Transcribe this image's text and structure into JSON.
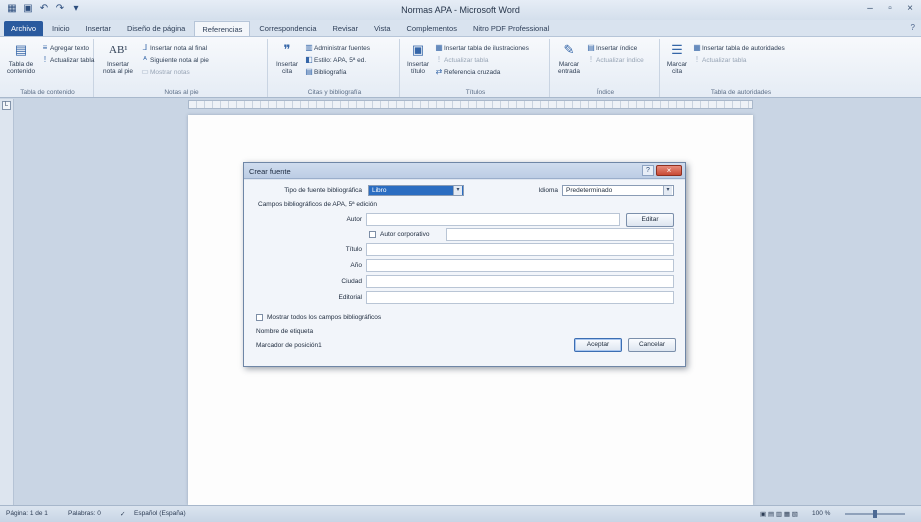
{
  "window": {
    "title": "Normas APA - Microsoft Word",
    "controls": [
      "–",
      "▫",
      "×"
    ]
  },
  "qat": [
    "▦",
    "▣",
    "↶",
    "↷",
    "▾"
  ],
  "tabs": [
    "Archivo",
    "Inicio",
    "Insertar",
    "Diseño de página",
    "Referencias",
    "Correspondencia",
    "Revisar",
    "Vista",
    "Complementos",
    "Nitro PDF Professional"
  ],
  "ribbon": {
    "toc": {
      "label": "Tabla de contenido",
      "add_text": "Agregar texto",
      "update": "Actualizar tabla",
      "group": "Tabla de contenido"
    },
    "footnotes": {
      "insert": "Insertar nota al pie",
      "big_icon": "AB¹",
      "endnote": "Insertar nota al final",
      "next": "Siguiente nota al pie",
      "show": "Mostrar notas",
      "group": "Notas al pie"
    },
    "citations": {
      "insert_citation": "Insertar cita",
      "manage": "Administrar fuentes",
      "style_label": "Estilo:",
      "style_value": "APA, 5ª ed.",
      "bibliography": "Bibliografía",
      "group": "Citas y bibliografía"
    },
    "captions": {
      "insert_caption": "Insertar título",
      "table_of_figures": "Insertar tabla de ilustraciones",
      "update": "Actualizar tabla",
      "cross_ref": "Referencia cruzada",
      "group": "Títulos"
    },
    "index": {
      "mark_entry": "Marcar entrada",
      "insert_index": "Insertar índice",
      "update": "Actualizar índice",
      "group": "Índice"
    },
    "authorities": {
      "mark_citation": "Marcar cita",
      "insert_table": "Insertar tabla de autoridades",
      "update": "Actualizar tabla",
      "group": "Tabla de autoridades"
    }
  },
  "dialog": {
    "title": "Crear fuente",
    "help": "?",
    "close": "×",
    "source_type_label": "Tipo de fuente bibliográfica",
    "source_type_value": "Libro",
    "language_label": "Idioma",
    "language_value": "Predeterminado",
    "fields_heading": "Campos bibliográficos de APA, 5ª edición",
    "author_label": "Autor",
    "edit_button": "Editar",
    "corporate_author": "Autor corporativo",
    "title_label": "Título",
    "year_label": "Año",
    "city_label": "Ciudad",
    "publisher_label": "Editorial",
    "show_all": "Mostrar todos los campos bibliográficos",
    "tag_label": "Nombre de etiqueta",
    "tag_value": "Marcador de posición1",
    "ok": "Aceptar",
    "cancel": "Cancelar"
  },
  "statusbar": {
    "page": "Página: 1 de 1",
    "words": "Palabras: 0",
    "language": "Español (España)",
    "zoom": "100 %"
  },
  "colors": {
    "accent": "#2a5a9e",
    "selection": "#2b6dc1",
    "close": "#c84a35"
  }
}
